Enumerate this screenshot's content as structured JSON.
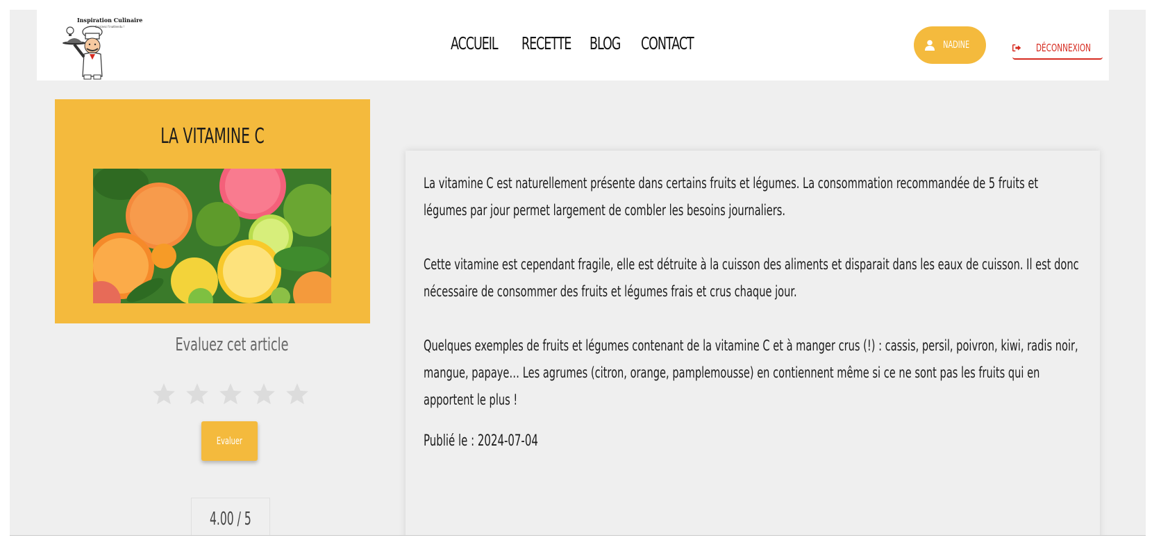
{
  "colors": {
    "accent": "#f4ba3d",
    "logout": "#d62a1f",
    "background": "#efefef"
  },
  "brand": {
    "logo_title": "Inspiration Culinaire",
    "logo_subtitle": "Cuisinez l'inattendu !"
  },
  "nav": {
    "links": [
      "ACCUEIL",
      "RECETTE",
      "BLOG",
      "CONTACT"
    ],
    "user_label": "NADINE",
    "user_icon": "user-icon",
    "logout_label": "DÉCONNEXION",
    "logout_icon": "sign-out-icon"
  },
  "article": {
    "title": "LA VITAMINE C",
    "image_alt": "citrus-fruits-image",
    "paragraphs": [
      "La vitamine C est naturellement présente dans certains fruits et légumes. La consommation recommandée de 5 fruits et légumes par jour permet largement de combler les besoins journaliers.",
      "Cette vitamine est cependant fragile, elle est détruite à la cuisson des aliments et disparait dans les eaux de cuisson. Il est donc nécessaire de consommer des fruits et légumes frais et crus chaque jour.",
      "Quelques exemples de fruits et légumes contenant de la vitamine C et à manger crus (!) : cassis, persil, poivron, kiwi, radis noir, mangue, papaye… Les agrumes (citron, orange, pamplemousse) en contiennent même si ce ne sont pas les fruits qui en apportent le plus !"
    ],
    "published": "Publié le : 2024-07-04"
  },
  "rating": {
    "title": "Evaluez cet article",
    "stars_total": 5,
    "stars_selected": 0,
    "button_label": "Evaluer",
    "score": "4.00 / 5"
  }
}
